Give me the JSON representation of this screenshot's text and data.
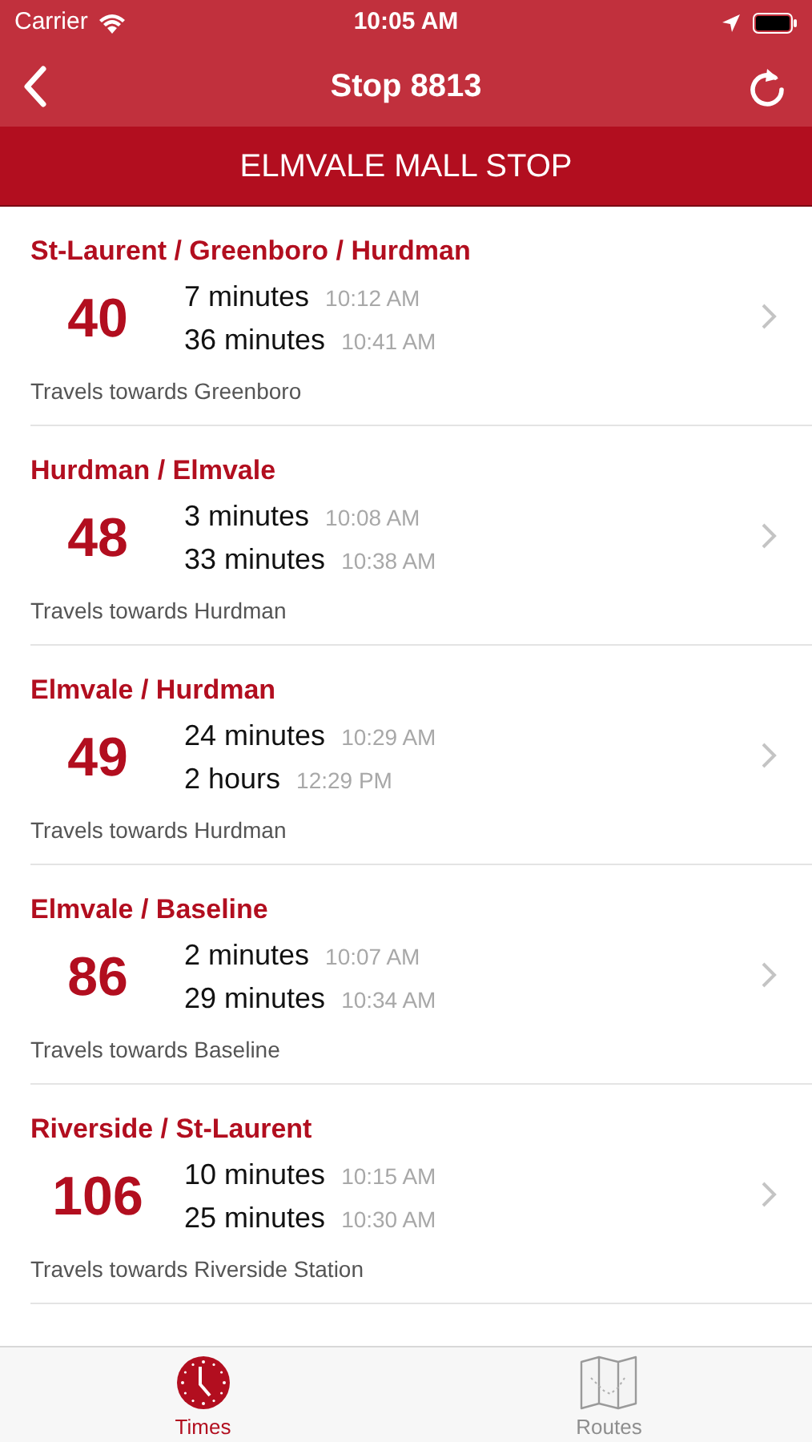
{
  "status_bar": {
    "carrier": "Carrier",
    "time": "10:05 AM"
  },
  "nav": {
    "title": "Stop 8813"
  },
  "stop_name": "ELMVALE MALL STOP",
  "routes": [
    {
      "name": "St-Laurent / Greenboro / Hurdman",
      "number": "40",
      "arrivals": [
        {
          "wait": "7 minutes",
          "time": "10:12 AM"
        },
        {
          "wait": "36 minutes",
          "time": "10:41 AM"
        }
      ],
      "direction": "Travels towards Greenboro"
    },
    {
      "name": "Hurdman / Elmvale",
      "number": "48",
      "arrivals": [
        {
          "wait": "3 minutes",
          "time": "10:08 AM"
        },
        {
          "wait": "33 minutes",
          "time": "10:38 AM"
        }
      ],
      "direction": "Travels towards Hurdman"
    },
    {
      "name": "Elmvale / Hurdman",
      "number": "49",
      "arrivals": [
        {
          "wait": "24 minutes",
          "time": "10:29 AM"
        },
        {
          "wait": "2 hours",
          "time": "12:29 PM"
        }
      ],
      "direction": "Travels towards Hurdman"
    },
    {
      "name": "Elmvale / Baseline",
      "number": "86",
      "arrivals": [
        {
          "wait": "2 minutes",
          "time": "10:07 AM"
        },
        {
          "wait": "29 minutes",
          "time": "10:34 AM"
        }
      ],
      "direction": "Travels towards Baseline"
    },
    {
      "name": "Riverside / St-Laurent",
      "number": "106",
      "arrivals": [
        {
          "wait": "10 minutes",
          "time": "10:15 AM"
        },
        {
          "wait": "25 minutes",
          "time": "10:30 AM"
        }
      ],
      "direction": "Travels towards Riverside Station"
    }
  ],
  "tabs": [
    {
      "label": "Times",
      "selected": true,
      "kind": "clock"
    },
    {
      "label": "Routes",
      "selected": false,
      "kind": "map"
    }
  ]
}
